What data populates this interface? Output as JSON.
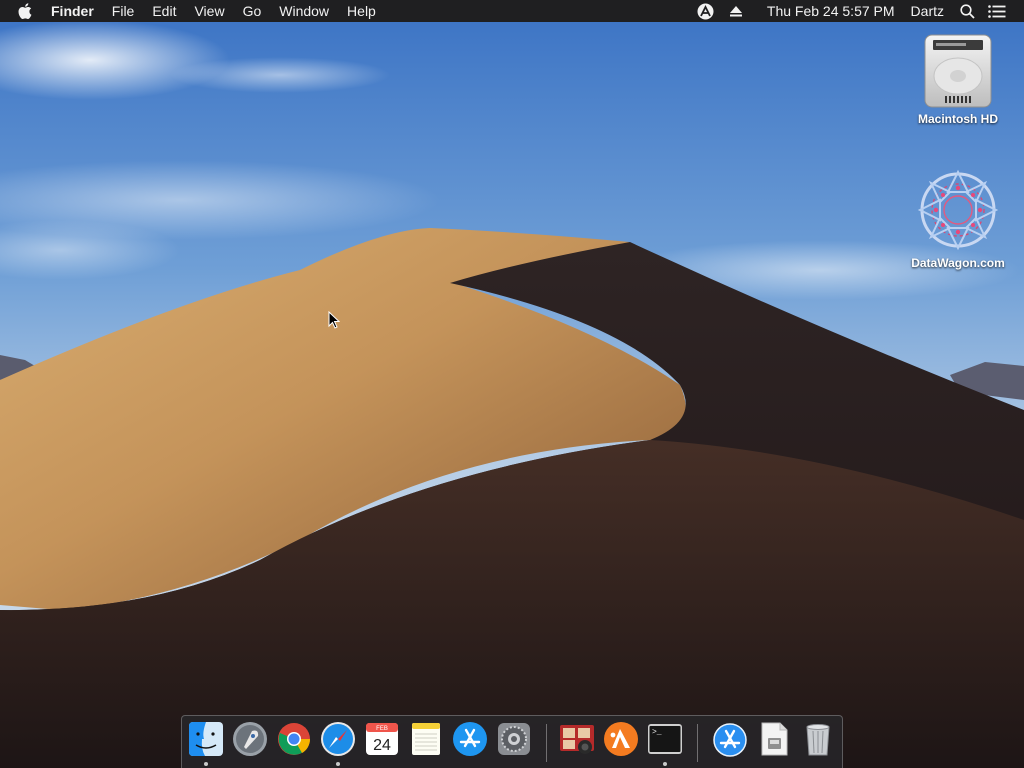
{
  "menubar": {
    "apple_icon": "apple-logo-icon",
    "app_name": "Finder",
    "menus": [
      "File",
      "Edit",
      "View",
      "Go",
      "Window",
      "Help"
    ],
    "status": {
      "user_status_icon": "accessibility-icon",
      "eject_icon": "eject-icon",
      "datetime": "Thu Feb 24  5:57 PM",
      "user": "Dartz",
      "search_icon": "spotlight-search-icon",
      "notifications_icon": "notification-center-icon"
    }
  },
  "desktop": {
    "icons": [
      {
        "label": "Macintosh HD",
        "icon": "hard-drive-icon"
      },
      {
        "label": "DataWagon.com",
        "icon": "mandala-icon"
      }
    ]
  },
  "dock": {
    "items": [
      {
        "name": "Finder",
        "icon": "finder-icon",
        "running": true
      },
      {
        "name": "Launchpad",
        "icon": "launchpad-icon",
        "running": false
      },
      {
        "name": "Google Chrome",
        "icon": "chrome-icon",
        "running": false
      },
      {
        "name": "Safari",
        "icon": "safari-icon",
        "running": true
      },
      {
        "name": "Calendar",
        "icon": "calendar-icon",
        "running": false,
        "month": "FEB",
        "day": "24"
      },
      {
        "name": "Notes",
        "icon": "notes-icon",
        "running": false
      },
      {
        "name": "App Store",
        "icon": "app-store-icon",
        "running": false
      },
      {
        "name": "System Preferences",
        "icon": "system-preferences-icon",
        "running": false
      },
      {
        "name": "Photo Booth",
        "icon": "photo-booth-icon",
        "running": false
      },
      {
        "name": "Avast",
        "icon": "avast-icon",
        "running": false
      },
      {
        "name": "Terminal",
        "icon": "terminal-icon",
        "running": true,
        "prompt": ">_"
      },
      {
        "name": "Applications",
        "icon": "applications-folder-icon",
        "running": false
      },
      {
        "name": "Document",
        "icon": "document-icon",
        "running": false
      },
      {
        "name": "Trash",
        "icon": "trash-icon",
        "running": false
      }
    ]
  },
  "colors": {
    "menubar_bg": "#1f1f21",
    "sky_top": "#3f77c9",
    "dune_light": "#c89a5e",
    "dune_shadow": "#2a1d1c"
  }
}
